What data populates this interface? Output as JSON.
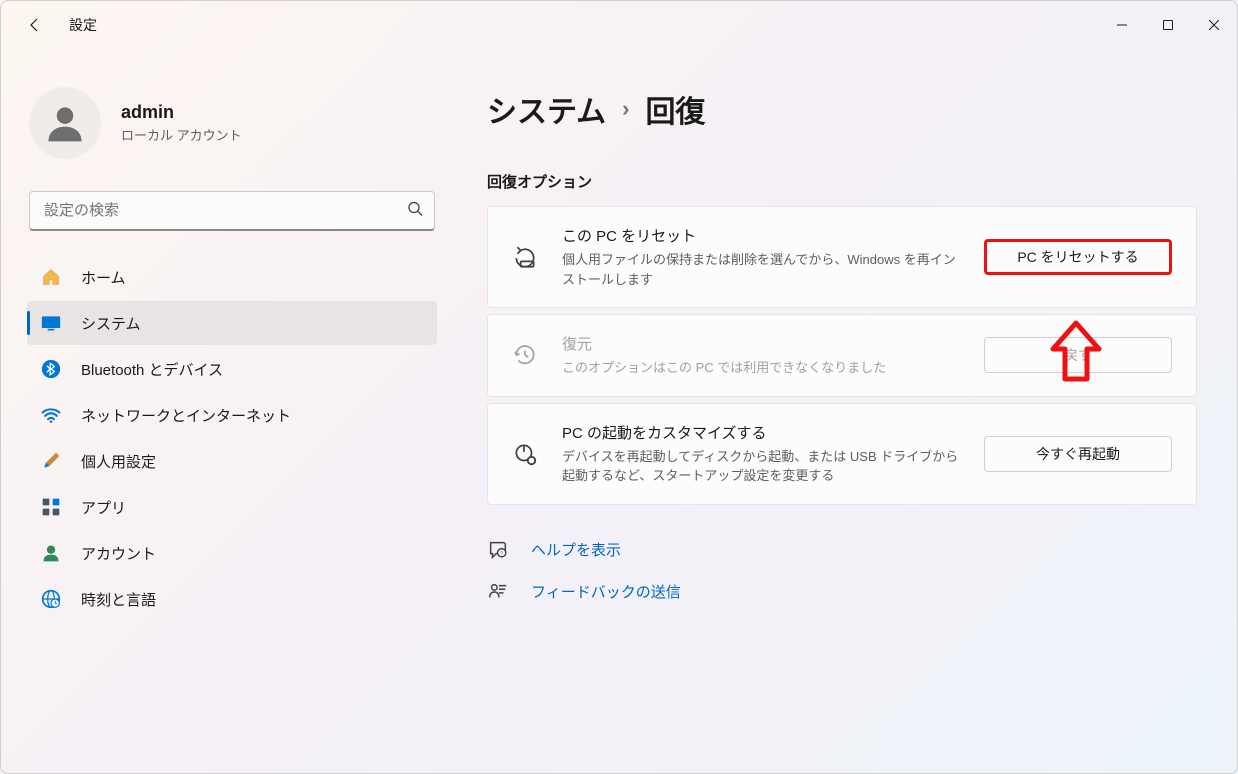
{
  "titlebar": {
    "app_title": "設定"
  },
  "profile": {
    "name": "admin",
    "subtitle": "ローカル アカウント"
  },
  "search": {
    "placeholder": "設定の検索"
  },
  "nav": {
    "home": "ホーム",
    "system": "システム",
    "bluetooth": "Bluetooth とデバイス",
    "network": "ネットワークとインターネット",
    "personalization": "個人用設定",
    "apps": "アプリ",
    "accounts": "アカウント",
    "time": "時刻と言語"
  },
  "breadcrumb": {
    "parent": "システム",
    "current": "回復"
  },
  "section": {
    "title": "回復オプション"
  },
  "cards": {
    "reset": {
      "title": "この PC をリセット",
      "desc": "個人用ファイルの保持または削除を選んでから、Windows を再インストールします",
      "button": "PC をリセットする"
    },
    "restore": {
      "title": "復元",
      "desc": "このオプションはこの PC では利用できなくなりました",
      "button": "戻す"
    },
    "startup": {
      "title": "PC の起動をカスタマイズする",
      "desc": "デバイスを再起動してディスクから起動、または USB ドライブから起動するなど、スタートアップ設定を変更する",
      "button": "今すぐ再起動"
    }
  },
  "links": {
    "help": "ヘルプを表示",
    "feedback": "フィードバックの送信"
  }
}
